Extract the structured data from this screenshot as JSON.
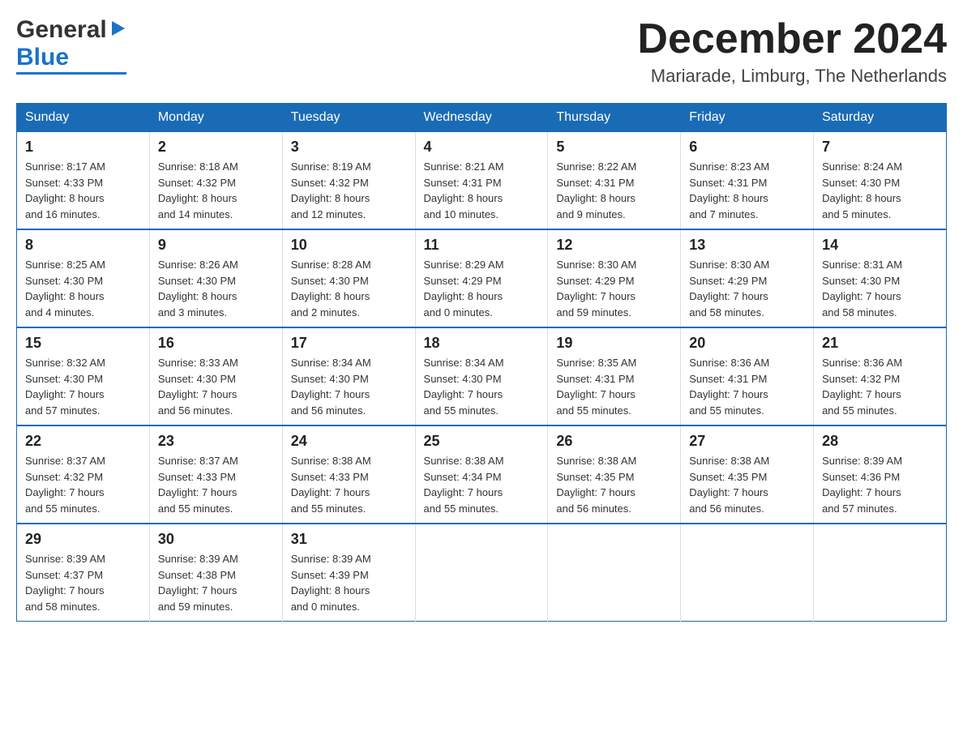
{
  "header": {
    "logo": {
      "general": "General",
      "triangle": "▶",
      "blue": "Blue"
    },
    "title": "December 2024",
    "location": "Mariarade, Limburg, The Netherlands"
  },
  "calendar": {
    "days_of_week": [
      "Sunday",
      "Monday",
      "Tuesday",
      "Wednesday",
      "Thursday",
      "Friday",
      "Saturday"
    ],
    "weeks": [
      [
        {
          "day": "1",
          "info": "Sunrise: 8:17 AM\nSunset: 4:33 PM\nDaylight: 8 hours\nand 16 minutes."
        },
        {
          "day": "2",
          "info": "Sunrise: 8:18 AM\nSunset: 4:32 PM\nDaylight: 8 hours\nand 14 minutes."
        },
        {
          "day": "3",
          "info": "Sunrise: 8:19 AM\nSunset: 4:32 PM\nDaylight: 8 hours\nand 12 minutes."
        },
        {
          "day": "4",
          "info": "Sunrise: 8:21 AM\nSunset: 4:31 PM\nDaylight: 8 hours\nand 10 minutes."
        },
        {
          "day": "5",
          "info": "Sunrise: 8:22 AM\nSunset: 4:31 PM\nDaylight: 8 hours\nand 9 minutes."
        },
        {
          "day": "6",
          "info": "Sunrise: 8:23 AM\nSunset: 4:31 PM\nDaylight: 8 hours\nand 7 minutes."
        },
        {
          "day": "7",
          "info": "Sunrise: 8:24 AM\nSunset: 4:30 PM\nDaylight: 8 hours\nand 5 minutes."
        }
      ],
      [
        {
          "day": "8",
          "info": "Sunrise: 8:25 AM\nSunset: 4:30 PM\nDaylight: 8 hours\nand 4 minutes."
        },
        {
          "day": "9",
          "info": "Sunrise: 8:26 AM\nSunset: 4:30 PM\nDaylight: 8 hours\nand 3 minutes."
        },
        {
          "day": "10",
          "info": "Sunrise: 8:28 AM\nSunset: 4:30 PM\nDaylight: 8 hours\nand 2 minutes."
        },
        {
          "day": "11",
          "info": "Sunrise: 8:29 AM\nSunset: 4:29 PM\nDaylight: 8 hours\nand 0 minutes."
        },
        {
          "day": "12",
          "info": "Sunrise: 8:30 AM\nSunset: 4:29 PM\nDaylight: 7 hours\nand 59 minutes."
        },
        {
          "day": "13",
          "info": "Sunrise: 8:30 AM\nSunset: 4:29 PM\nDaylight: 7 hours\nand 58 minutes."
        },
        {
          "day": "14",
          "info": "Sunrise: 8:31 AM\nSunset: 4:30 PM\nDaylight: 7 hours\nand 58 minutes."
        }
      ],
      [
        {
          "day": "15",
          "info": "Sunrise: 8:32 AM\nSunset: 4:30 PM\nDaylight: 7 hours\nand 57 minutes."
        },
        {
          "day": "16",
          "info": "Sunrise: 8:33 AM\nSunset: 4:30 PM\nDaylight: 7 hours\nand 56 minutes."
        },
        {
          "day": "17",
          "info": "Sunrise: 8:34 AM\nSunset: 4:30 PM\nDaylight: 7 hours\nand 56 minutes."
        },
        {
          "day": "18",
          "info": "Sunrise: 8:34 AM\nSunset: 4:30 PM\nDaylight: 7 hours\nand 55 minutes."
        },
        {
          "day": "19",
          "info": "Sunrise: 8:35 AM\nSunset: 4:31 PM\nDaylight: 7 hours\nand 55 minutes."
        },
        {
          "day": "20",
          "info": "Sunrise: 8:36 AM\nSunset: 4:31 PM\nDaylight: 7 hours\nand 55 minutes."
        },
        {
          "day": "21",
          "info": "Sunrise: 8:36 AM\nSunset: 4:32 PM\nDaylight: 7 hours\nand 55 minutes."
        }
      ],
      [
        {
          "day": "22",
          "info": "Sunrise: 8:37 AM\nSunset: 4:32 PM\nDaylight: 7 hours\nand 55 minutes."
        },
        {
          "day": "23",
          "info": "Sunrise: 8:37 AM\nSunset: 4:33 PM\nDaylight: 7 hours\nand 55 minutes."
        },
        {
          "day": "24",
          "info": "Sunrise: 8:38 AM\nSunset: 4:33 PM\nDaylight: 7 hours\nand 55 minutes."
        },
        {
          "day": "25",
          "info": "Sunrise: 8:38 AM\nSunset: 4:34 PM\nDaylight: 7 hours\nand 55 minutes."
        },
        {
          "day": "26",
          "info": "Sunrise: 8:38 AM\nSunset: 4:35 PM\nDaylight: 7 hours\nand 56 minutes."
        },
        {
          "day": "27",
          "info": "Sunrise: 8:38 AM\nSunset: 4:35 PM\nDaylight: 7 hours\nand 56 minutes."
        },
        {
          "day": "28",
          "info": "Sunrise: 8:39 AM\nSunset: 4:36 PM\nDaylight: 7 hours\nand 57 minutes."
        }
      ],
      [
        {
          "day": "29",
          "info": "Sunrise: 8:39 AM\nSunset: 4:37 PM\nDaylight: 7 hours\nand 58 minutes."
        },
        {
          "day": "30",
          "info": "Sunrise: 8:39 AM\nSunset: 4:38 PM\nDaylight: 7 hours\nand 59 minutes."
        },
        {
          "day": "31",
          "info": "Sunrise: 8:39 AM\nSunset: 4:39 PM\nDaylight: 8 hours\nand 0 minutes."
        },
        {
          "day": "",
          "info": ""
        },
        {
          "day": "",
          "info": ""
        },
        {
          "day": "",
          "info": ""
        },
        {
          "day": "",
          "info": ""
        }
      ]
    ]
  }
}
